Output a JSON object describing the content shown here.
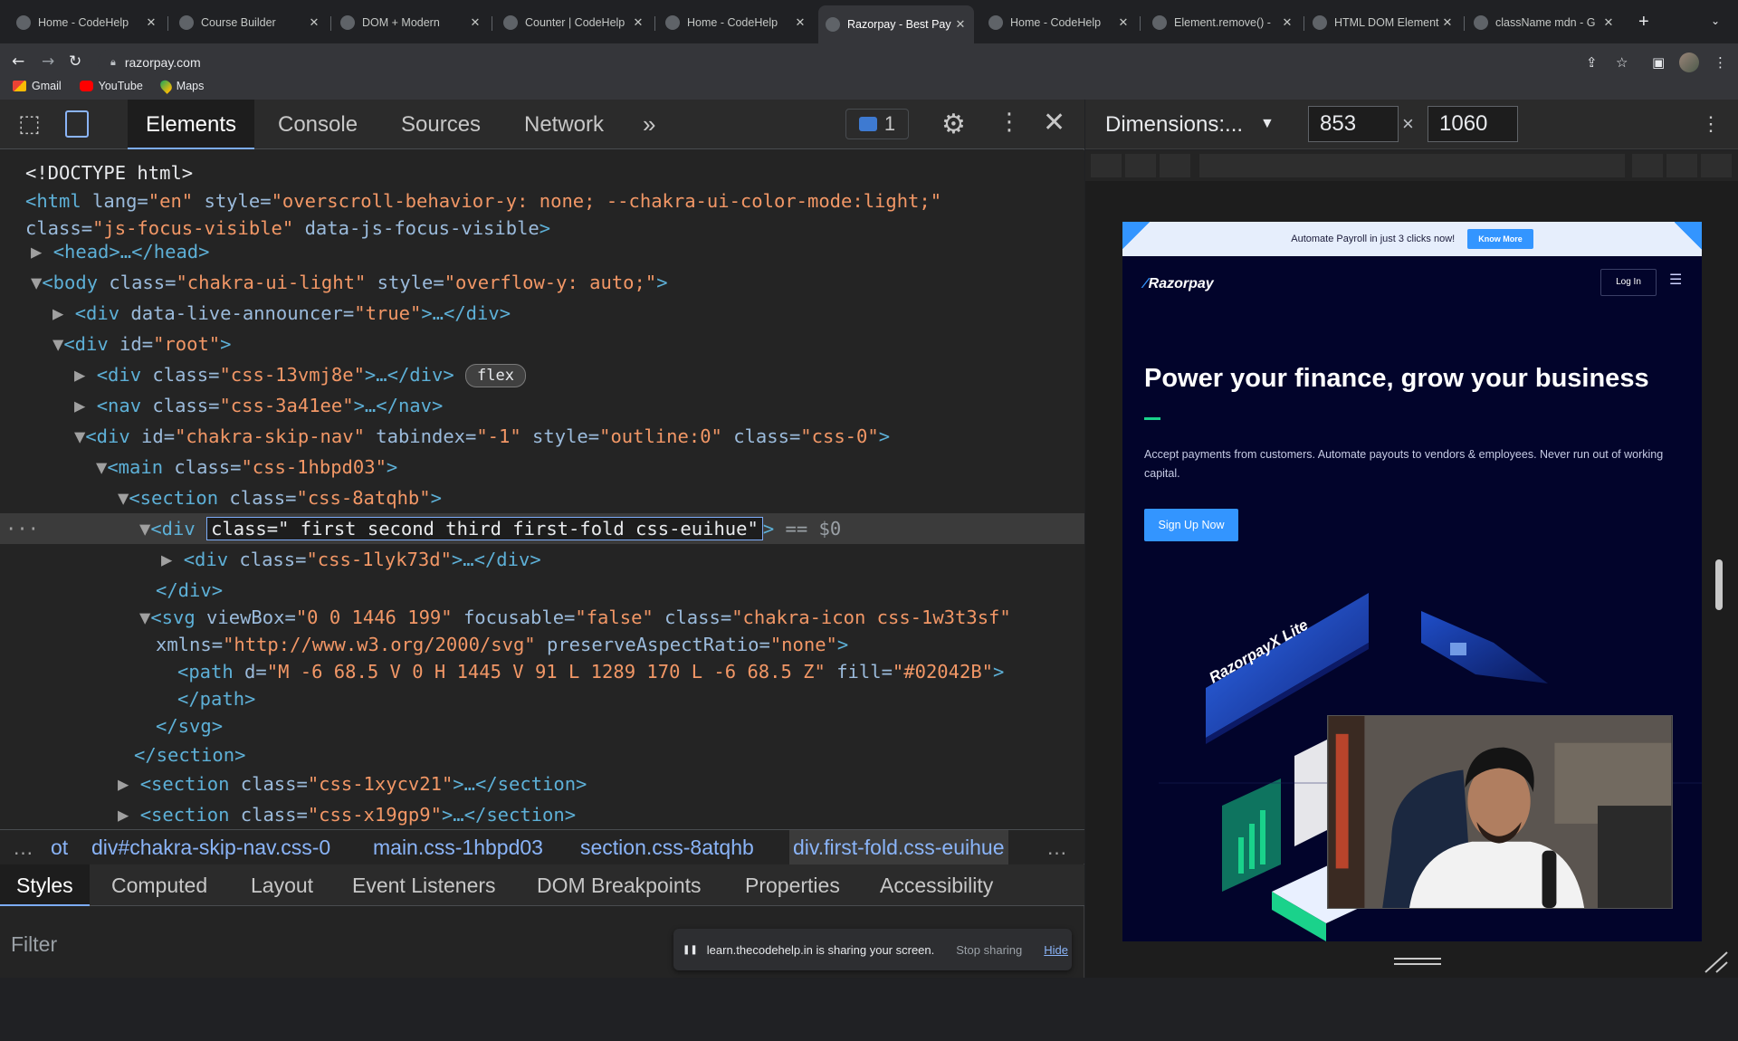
{
  "browser": {
    "tabs": [
      {
        "title": "Home - CodeHelp",
        "favicon": "codehelp-icon"
      },
      {
        "title": "Course Builder",
        "favicon": "course-builder-icon"
      },
      {
        "title": "DOM + Modern",
        "favicon": "dom-modern-icon"
      },
      {
        "title": "Counter | CodeHelp",
        "favicon": "globe-icon"
      },
      {
        "title": "Home - CodeHelp",
        "favicon": "codehelp-icon"
      },
      {
        "title": "Razorpay - Best Pay",
        "favicon": "razorpay-icon",
        "active": true
      },
      {
        "title": "Home - CodeHelp",
        "favicon": "codehelp-icon"
      },
      {
        "title": "Element.remove() -",
        "favicon": "mdn-icon"
      },
      {
        "title": "HTML DOM Element",
        "favicon": "w3schools-icon"
      },
      {
        "title": "className mdn - G",
        "favicon": "google-icon"
      }
    ],
    "url": "razorpay.com",
    "bookmarks": [
      "Gmail",
      "YouTube",
      "Maps"
    ]
  },
  "devtools": {
    "tabs": [
      "Elements",
      "Console",
      "Sources",
      "Network"
    ],
    "more": "»",
    "issues_count": "1",
    "dom_lines": {
      "l1": "<!DOCTYPE html>",
      "l2_tag": "<html",
      "l2_attr1_name": " lang=",
      "l2_attr1_val": "\"en\"",
      "l2_attr2_name": " style=",
      "l2_attr2_val": "\"overscroll-behavior-y: none; --chakra-ui-color-mode:light;\"",
      "l3_attr_name": "class=",
      "l3_attr_val": "\"js-focus-visible\"",
      "l3_attr2": " data-js-focus-visible",
      "l3_end": ">",
      "l4": "<head>…</head>",
      "l5_tag": "<body",
      "l5_attr1_name": " class=",
      "l5_attr1_val": "\"chakra-ui-light\"",
      "l5_attr2_name": " style=",
      "l5_attr2_val": "\"overflow-y: auto;\"",
      "l5_end": ">",
      "l6_tag": "<div",
      "l6_attr_name": " data-live-announcer=",
      "l6_attr_val": "\"true\"",
      "l6_end": ">…</div>",
      "l7_tag": "<div",
      "l7_attr_name": " id=",
      "l7_attr_val": "\"root\"",
      "l7_end": ">",
      "l8_tag": "<div",
      "l8_attr_name": " class=",
      "l8_attr_val": "\"css-13vmj8e\"",
      "l8_end": ">…</div>",
      "l8_badge": "flex",
      "l9_tag": "<nav",
      "l9_attr_name": " class=",
      "l9_attr_val": "\"css-3a41ee\"",
      "l9_end": ">…</nav>",
      "l10_tag": "<div",
      "l10_a1n": " id=",
      "l10_a1v": "\"chakra-skip-nav\"",
      "l10_a2n": " tabindex=",
      "l10_a2v": "\"-1\"",
      "l10_a3n": " style=",
      "l10_a3v": "\"outline:0\"",
      "l10_a4n": " class=",
      "l10_a4v": "\"css-0\"",
      "l10_end": ">",
      "l11_tag": "<main",
      "l11_attr_name": " class=",
      "l11_attr_val": "\"css-1hbpd03\"",
      "l11_end": ">",
      "l12_tag": "<section",
      "l12_attr_name": " class=",
      "l12_attr_val": "\"css-8atqhb\"",
      "l12_end": ">",
      "l13_tag": "<div",
      "l13_edit": "class=\" first second third first-fold css-euihue\"",
      "l13_end": ">",
      "l13_eq": " == $0",
      "l14_tag": "<div",
      "l14_attr_name": " class=",
      "l14_attr_val": "\"css-1lyk73d\"",
      "l14_end": ">…</div>",
      "l15": "</div>",
      "l16_tag": "<svg",
      "l16_a1n": " viewBox=",
      "l16_a1v": "\"0 0 1446 199\"",
      "l16_a2n": " focusable=",
      "l16_a2v": "\"false\"",
      "l16_a3n": " class=",
      "l16_a3v": "\"chakra-icon css-1w3t3sf\"",
      "l17_a1n": "xmlns=",
      "l17_a1v": "\"http://www.w3.org/2000/svg\"",
      "l17_a2n": " preserveAspectRatio=",
      "l17_a2v": "\"none\"",
      "l17_end": ">",
      "l18_tag": "<path",
      "l18_a1n": " d=",
      "l18_a1v": "\"M -6 68.5 V 0 H 1445 V 91 L 1289 170 L -6 68.5 Z\"",
      "l18_a2n": " fill=",
      "l18_a2v": "\"#02042B\"",
      "l18_end": ">",
      "l19": "</path>",
      "l20": "</svg>",
      "l21": "</section>",
      "l22_tag": "<section",
      "l22_attr_name": " class=",
      "l22_attr_val": "\"css-1xycv21\"",
      "l22_end": ">…</section>",
      "l23_tag": "<section",
      "l23_attr_name": " class=",
      "l23_attr_val": "\"css-x19gp9\"",
      "l23_end": ">…</section>"
    },
    "breadcrumbs": [
      "…",
      "ot",
      "div#chakra-skip-nav.css-0",
      "main.css-1hbpd03",
      "section.css-8atqhb",
      "div.first-fold.css-euihue",
      "…"
    ],
    "styles_tabs": [
      "Styles",
      "Computed",
      "Layout",
      "Event Listeners",
      "DOM Breakpoints",
      "Properties",
      "Accessibility"
    ],
    "filter_placeholder": "Filter"
  },
  "device_toolbar": {
    "dimensions_label": "Dimensions:...",
    "width": "853",
    "height": "1060",
    "x_sign": "×"
  },
  "screen_share": {
    "message": "learn.thecodehelp.in is sharing your screen.",
    "stop": "Stop sharing",
    "hide": "Hide"
  },
  "razorpay": {
    "banner_text": "Automate Payroll in just 3 clicks now!",
    "banner_button": "Know More",
    "logo": "Razorpay",
    "login": "Log In",
    "headline": "Power your finance, grow your business",
    "subtext": "Accept payments from customers. Automate payouts to vendors & employees. Never run out of working capital.",
    "cta": "Sign Up Now",
    "card_label": "RazorpayX Lite"
  },
  "colors": {
    "razorpay_blue": "#3395ff",
    "razorpay_navy": "#02042b",
    "devtools_bg": "#242424",
    "selection_blue": "#7cacf8"
  }
}
